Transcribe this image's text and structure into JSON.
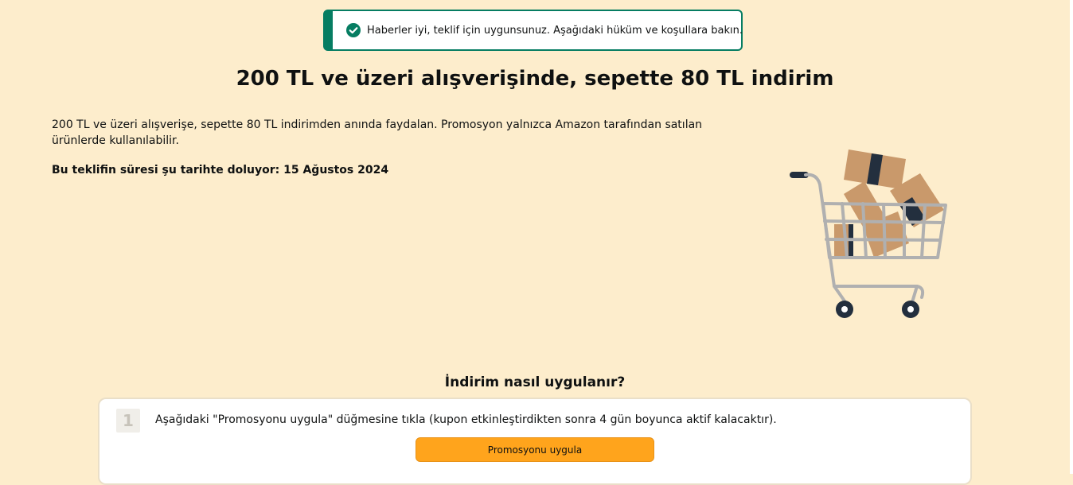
{
  "alert": {
    "icon": "check-circle-icon",
    "text": "Haberler iyi, teklif için uygunsunuz. Aşağıdaki hüküm ve koşullara bakın.",
    "color": "#067d62"
  },
  "offer": {
    "title": "200 TL ve üzeri alışverişinde, sepette 80 TL indirim",
    "description": "200 TL ve üzeri alışverişe, sepette 80 TL indirimden anında faydalan. Promosyon yalnızca Amazon tarafından satılan ürünlerde kullanılabilir.",
    "expiry": "Bu teklifin süresi şu tarihte doluyor: 15 Ağustos 2024",
    "illustration": "shopping-cart-icon"
  },
  "how_to": {
    "title": "İndirim nasıl uygulanır?",
    "steps": [
      {
        "number": "1",
        "text": "Aşağıdaki \"Promosyonu uygula\" düğmesine tıkla (kupon etkinleştirdikten sonra 4 gün boyunca aktif kalacaktır).",
        "button_label": "Promosyonu uygula"
      }
    ]
  },
  "colors": {
    "background": "#fdedcc",
    "success": "#067d62",
    "button": "#ffa41c"
  }
}
